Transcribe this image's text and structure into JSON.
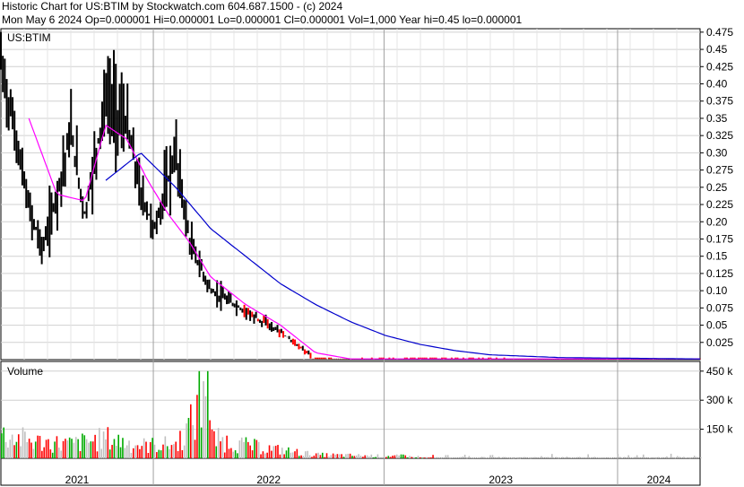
{
  "header": {
    "line1": "Historic Chart for US:BTIM by Stockwatch.com 604.687.1500 - (c) 2024",
    "line2": "Mon May  6 2024   Op=0.000001   Hi=0.000001   Lo=0.000001   Cl=0.000001   Vol=1,000   Year hi=0.45   lo=0.000001"
  },
  "chart_data": [
    {
      "type": "ohlc",
      "title": "US:BTIM",
      "y_ticks": [
        "0.475",
        "0.45",
        "0.425",
        "0.40",
        "0.375",
        "0.35",
        "0.325",
        "0.30",
        "0.275",
        "0.25",
        "0.225",
        "0.20",
        "0.175",
        "0.15",
        "0.125",
        "0.10",
        "0.075",
        "0.05",
        "0.025"
      ],
      "ylim": [
        0,
        0.48
      ],
      "x_axis_labels": [
        "2021",
        "2022",
        "2023",
        "2024"
      ],
      "grid": true,
      "series": [
        {
          "kind": "price",
          "color": "#000000",
          "x": [
            0,
            0.02,
            0.04,
            0.06,
            0.08,
            0.1,
            0.12,
            0.15,
            0.18,
            0.2,
            0.22,
            0.25,
            0.27,
            0.3,
            0.35,
            0.4,
            0.45,
            0.5,
            0.55,
            0.6,
            0.7,
            0.8,
            1.0
          ],
          "values": [
            0.43,
            0.33,
            0.22,
            0.16,
            0.24,
            0.33,
            0.21,
            0.38,
            0.34,
            0.24,
            0.19,
            0.3,
            0.17,
            0.1,
            0.07,
            0.04,
            0.001,
            0.001,
            0.001,
            0.001,
            0.001,
            0.001,
            1e-06
          ]
        },
        {
          "kind": "moving-average-short",
          "color": "#ff00ff",
          "x": [
            0.04,
            0.08,
            0.12,
            0.15,
            0.18,
            0.21,
            0.24,
            0.27,
            0.3,
            0.35,
            0.4,
            0.45,
            0.5,
            1.0
          ],
          "values": [
            0.35,
            0.24,
            0.23,
            0.34,
            0.32,
            0.26,
            0.21,
            0.17,
            0.12,
            0.08,
            0.05,
            0.01,
            0.001,
            0.001
          ]
        },
        {
          "kind": "moving-average-long",
          "color": "#0000cc",
          "x": [
            0.15,
            0.2,
            0.25,
            0.3,
            0.35,
            0.4,
            0.45,
            0.5,
            0.55,
            0.6,
            0.65,
            0.7,
            0.8,
            0.9,
            1.0
          ],
          "values": [
            0.26,
            0.3,
            0.25,
            0.19,
            0.15,
            0.11,
            0.08,
            0.055,
            0.035,
            0.022,
            0.013,
            0.007,
            0.003,
            0.002,
            0.001
          ]
        }
      ]
    },
    {
      "type": "bar",
      "title": "Volume",
      "y_ticks": [
        "450 k",
        "300 k",
        "150 k"
      ],
      "ylim": [
        0,
        500000
      ],
      "colors": {
        "up": "#00aa00",
        "down": "#ff0000",
        "unchanged": "#c0c0c0"
      },
      "values_note_free": true,
      "x": [
        0.0,
        0.05,
        0.1,
        0.15,
        0.2,
        0.25,
        0.29,
        0.3,
        0.35,
        0.45,
        0.55,
        0.88
      ],
      "values": [
        200000,
        140000,
        120000,
        170000,
        110000,
        120000,
        450000,
        170000,
        110000,
        30000,
        20000,
        25000
      ]
    }
  ]
}
